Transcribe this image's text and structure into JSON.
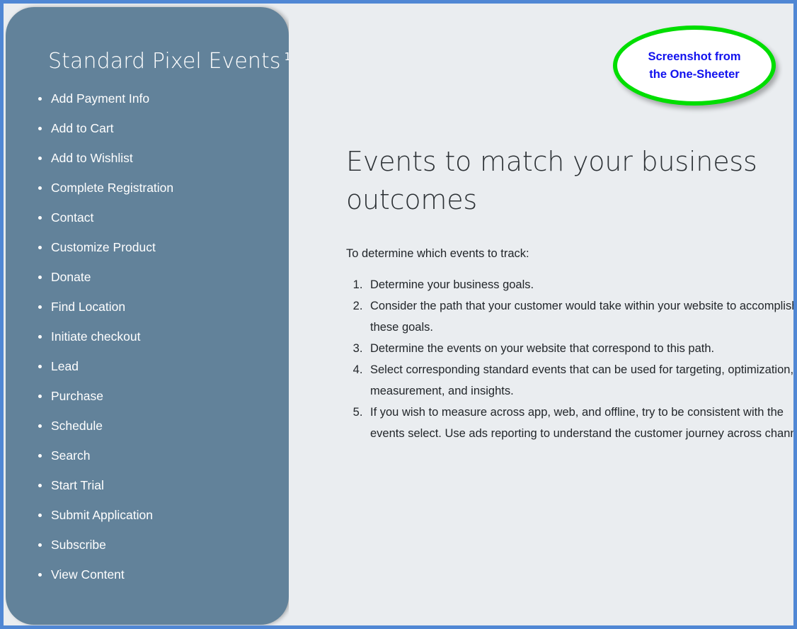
{
  "sidebar": {
    "title": "Standard Pixel Events",
    "title_superscript": "1",
    "background_color": "#62829a",
    "text_color": "#ffffff",
    "items": [
      {
        "label": "Add Payment Info"
      },
      {
        "label": "Add to Cart"
      },
      {
        "label": "Add to Wishlist"
      },
      {
        "label": "Complete Registration"
      },
      {
        "label": "Contact"
      },
      {
        "label": "Customize Product"
      },
      {
        "label": "Donate"
      },
      {
        "label": "Find Location"
      },
      {
        "label": "Initiate checkout"
      },
      {
        "label": "Lead"
      },
      {
        "label": "Purchase"
      },
      {
        "label": "Schedule"
      },
      {
        "label": "Search"
      },
      {
        "label": "Start Trial"
      },
      {
        "label": "Submit Application"
      },
      {
        "label": "Subscribe"
      },
      {
        "label": "View Content"
      }
    ]
  },
  "main": {
    "heading": "Events to match your business outcomes",
    "intro": "To determine which events to track:",
    "steps": [
      "Determine your business goals.",
      "Consider the path that your customer would take within your website to accomplish these goals.",
      "Determine the events on your website that correspond to this path.",
      "Select corresponding standard events that can be used for targeting, optimization, measurement, and insights.",
      "If you wish to measure across app, web, and offline, try to be consistent with the events select. Use ads reporting to understand the customer journey across channels."
    ],
    "background_color": "#eaedf0",
    "heading_color": "#2c3135"
  },
  "callout": {
    "text": "Screenshot from the One-Sheeter",
    "border_color": "#00de00",
    "text_color": "#1111ee",
    "fill_color": "#ffffff"
  },
  "frame": {
    "border_color": "#5087d4"
  }
}
